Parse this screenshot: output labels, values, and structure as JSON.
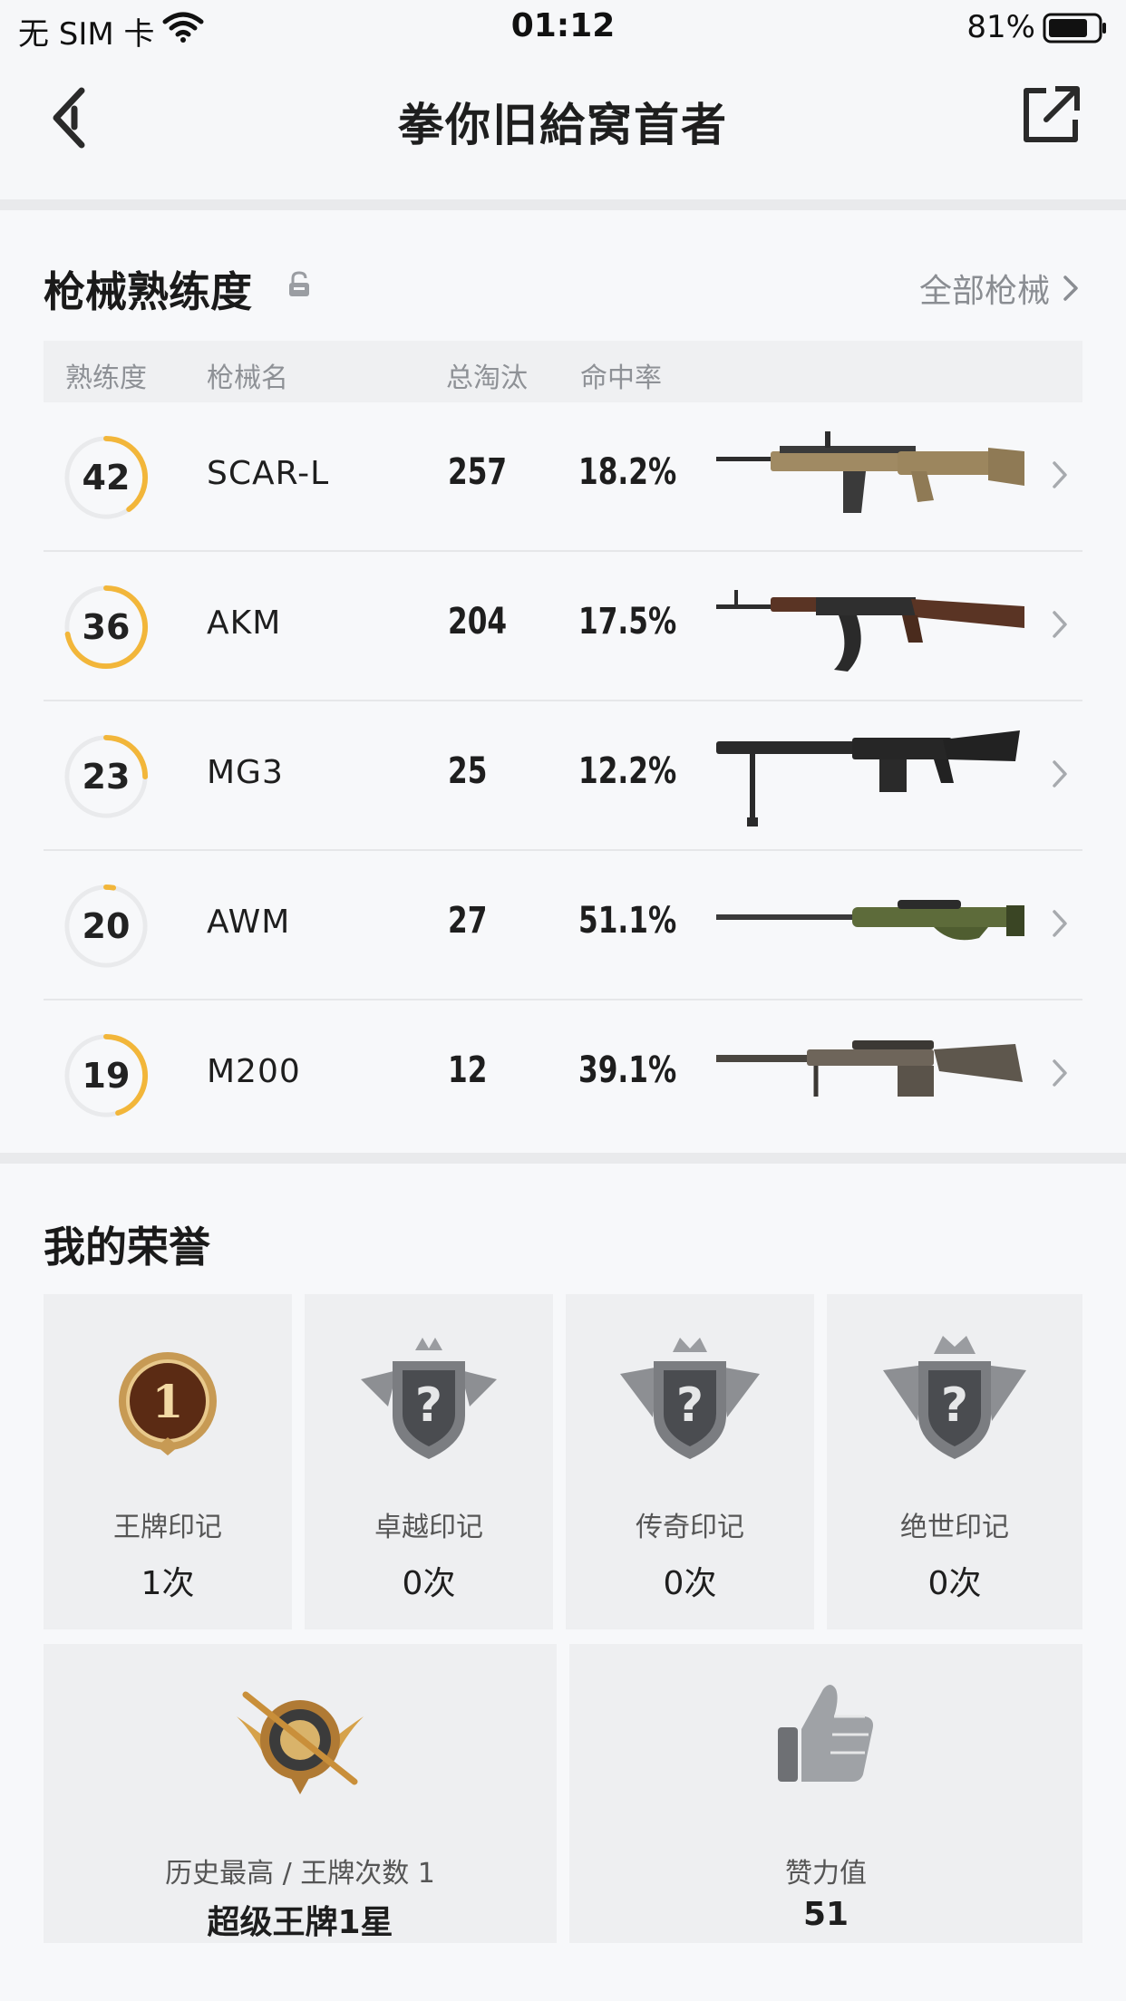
{
  "status": {
    "carrier": "无 SIM 卡",
    "time": "01:12",
    "battery": "81%"
  },
  "nav": {
    "title": "拳你旧給窝首者"
  },
  "weapons": {
    "section_title": "枪械熟练度",
    "all_link": "全部枪械",
    "headers": {
      "level": "熟练度",
      "name": "枪械名",
      "kills": "总淘汰",
      "hit_rate": "命中率"
    },
    "rows": [
      {
        "level": "42",
        "progress": 0.4,
        "name": "SCAR-L",
        "kills": "257",
        "hit_rate": "18.2%"
      },
      {
        "level": "36",
        "progress": 0.72,
        "name": "AKM",
        "kills": "204",
        "hit_rate": "17.5%"
      },
      {
        "level": "23",
        "progress": 0.25,
        "name": "MG3",
        "kills": "25",
        "hit_rate": "12.2%"
      },
      {
        "level": "20",
        "progress": 0.03,
        "name": "AWM",
        "kills": "27",
        "hit_rate": "51.1%"
      },
      {
        "level": "19",
        "progress": 0.45,
        "name": "M200",
        "kills": "12",
        "hit_rate": "39.1%"
      }
    ]
  },
  "honor": {
    "section_title": "我的荣誉",
    "marks": [
      {
        "label": "王牌印记",
        "value": "1次",
        "icon": "ace-medal-icon"
      },
      {
        "label": "卓越印记",
        "value": "0次",
        "icon": "locked-badge-icon"
      },
      {
        "label": "传奇印记",
        "value": "0次",
        "icon": "locked-badge-icon"
      },
      {
        "label": "绝世印记",
        "value": "0次",
        "icon": "locked-badge-icon"
      }
    ],
    "summary": [
      {
        "label": "历史最高 / 王牌次数 1",
        "value": "超级王牌1星",
        "icon": "super-ace-emblem-icon"
      },
      {
        "label": "赞力值",
        "value": "51",
        "icon": "thumbs-up-icon"
      }
    ]
  },
  "colors": {
    "ring_active": "#f2b63a",
    "ring_track": "#e9eaec",
    "accent_text": "#1e1e1e"
  }
}
